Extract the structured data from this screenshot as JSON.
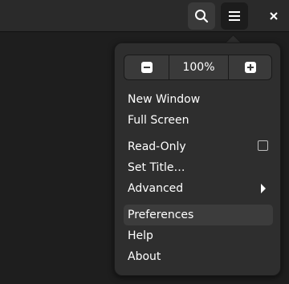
{
  "headerbar": {
    "search_icon": "search-icon",
    "menu_icon": "hamburger-menu-icon",
    "close_icon": "close-icon"
  },
  "menu": {
    "zoom": {
      "zoom_out_icon": "zoom-out-icon",
      "value": "100%",
      "zoom_in_icon": "zoom-in-icon"
    },
    "items": [
      {
        "label": "New Window"
      },
      {
        "label": "Full Screen"
      },
      {
        "label": "Read-Only",
        "type": "checkbox",
        "checked": false
      },
      {
        "label": "Set Title…"
      },
      {
        "label": "Advanced",
        "type": "submenu"
      },
      {
        "label": "Preferences",
        "highlighted": true
      },
      {
        "label": "Help"
      },
      {
        "label": "About"
      }
    ]
  },
  "colors": {
    "background": "#1e1e1e",
    "headerbar": "#2a2a2a",
    "popover": "#2e2e2e",
    "highlight": "#3c3c3c"
  }
}
